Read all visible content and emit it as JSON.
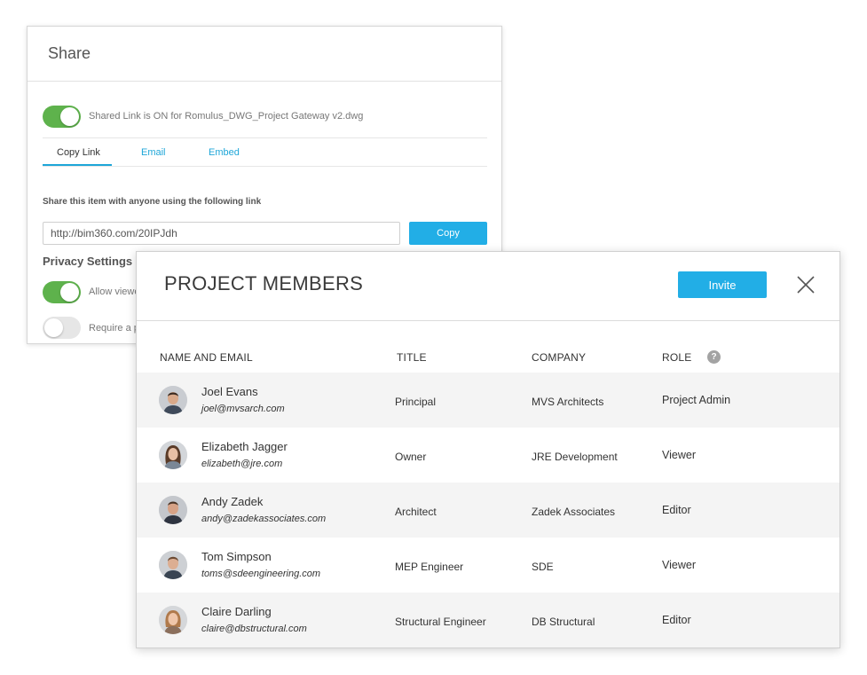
{
  "share": {
    "title": "Share",
    "link_status": "Shared Link is ON for Romulus_DWG_Project Gateway v2.dwg",
    "tabs": [
      {
        "label": "Copy Link",
        "active": true
      },
      {
        "label": "Email",
        "active": false
      },
      {
        "label": "Embed",
        "active": false
      }
    ],
    "instructions": "Share this item with anyone using the following link",
    "link_url": "http://bim360.com/20IPJdh",
    "copy_label": "Copy",
    "privacy_heading": "Privacy Settings",
    "viewers_toggle_label": "Allow viewe",
    "password_toggle_label": "Require a p",
    "toggle_on_color": "#5eb24c",
    "accent_color": "#22aee6"
  },
  "members": {
    "title": "PROJECT MEMBERS",
    "invite_label": "Invite",
    "close_icon": "close-icon",
    "columns": {
      "name_email": "NAME AND EMAIL",
      "title": "TITLE",
      "company": "COMPANY",
      "role": "ROLE",
      "role_help": "?"
    },
    "rows": [
      {
        "name": "Joel Evans",
        "email": "joel@mvsarch.com",
        "title": "Principal",
        "company": "MVS Architects",
        "role": "Project Admin"
      },
      {
        "name": "Elizabeth Jagger",
        "email": "elizabeth@jre.com",
        "title": "Owner",
        "company": "JRE Development",
        "role": "Viewer"
      },
      {
        "name": "Andy Zadek",
        "email": "andy@zadekassociates.com",
        "title": "Architect",
        "company": "Zadek Associates",
        "role": "Editor"
      },
      {
        "name": "Tom Simpson",
        "email": "toms@sdeengineering.com",
        "title": "MEP Engineer",
        "company": "SDE",
        "role": "Viewer"
      },
      {
        "name": "Claire Darling",
        "email": "claire@dbstructural.com",
        "title": "Structural Engineer",
        "company": "DB Structural",
        "role": "Editor"
      }
    ]
  }
}
